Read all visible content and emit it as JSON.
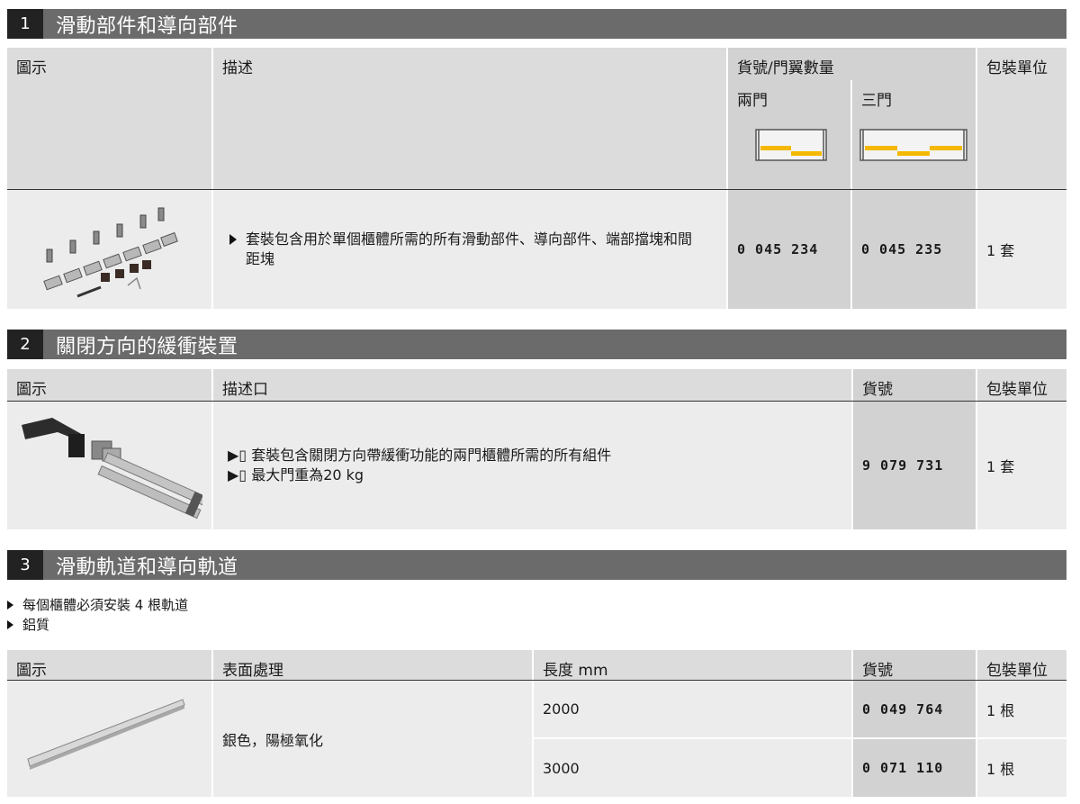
{
  "s1": {
    "number": "1",
    "title": "滑動部件和導向部件",
    "headers": {
      "image": "圖示",
      "desc": "描述",
      "article_group": "貨號/門翼數量",
      "two_door": "兩門",
      "three_door": "三門",
      "pack": "包裝單位"
    },
    "row": {
      "desc": "套裝包含用於單個櫃體所需的所有滑動部件、導向部件、端部擋塊和間距塊",
      "code_two": "0 045 234",
      "code_three": "0 045 235",
      "pack": "1 套"
    },
    "accent_color": "#f5b800"
  },
  "s2": {
    "number": "2",
    "title": "關閉方向的緩衝裝置",
    "headers": {
      "image": "圖示",
      "desc": "描述口",
      "code": "貨號",
      "pack": "包裝單位"
    },
    "row": {
      "desc1": "▶▯ 套裝包含關閉方向帶緩衝功能的兩門櫃體所需的所有組件",
      "desc2": "▶▯ 最大門重為20 kg",
      "code": "9 079 731",
      "pack": "1 套"
    }
  },
  "s3": {
    "number": "3",
    "title": "滑動軌道和導向軌道",
    "notes": [
      "每個櫃體必須安裝 4 根軌道",
      "鋁質"
    ],
    "headers": {
      "image": "圖示",
      "finish": "表面處理",
      "length": "長度 mm",
      "code": "貨號",
      "pack": "包裝單位"
    },
    "finish": "銀色，陽極氧化",
    "rows": [
      {
        "length": "2000",
        "code": "0 049 764",
        "pack": "1 根"
      },
      {
        "length": "3000",
        "code": "0 071 110",
        "pack": "1 根"
      }
    ]
  }
}
